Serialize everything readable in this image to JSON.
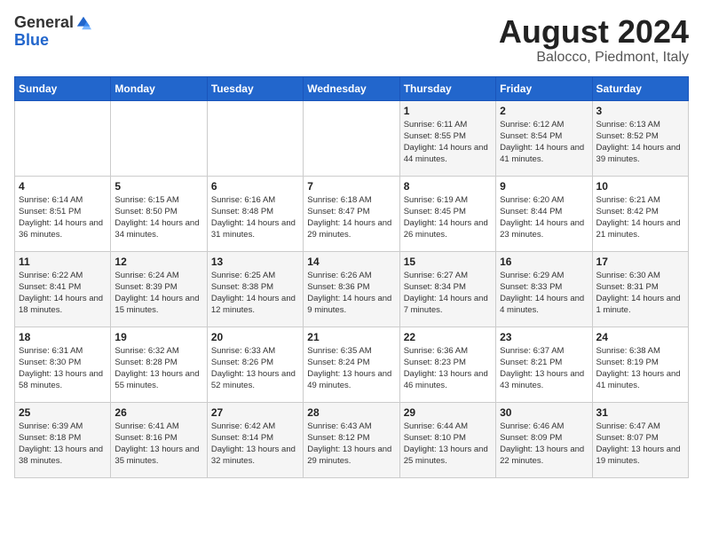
{
  "header": {
    "logo_general": "General",
    "logo_blue": "Blue",
    "title": "August 2024",
    "subtitle": "Balocco, Piedmont, Italy"
  },
  "weekdays": [
    "Sunday",
    "Monday",
    "Tuesday",
    "Wednesday",
    "Thursday",
    "Friday",
    "Saturday"
  ],
  "weeks": [
    [
      {
        "day": "",
        "info": ""
      },
      {
        "day": "",
        "info": ""
      },
      {
        "day": "",
        "info": ""
      },
      {
        "day": "",
        "info": ""
      },
      {
        "day": "1",
        "info": "Sunrise: 6:11 AM\nSunset: 8:55 PM\nDaylight: 14 hours and 44 minutes."
      },
      {
        "day": "2",
        "info": "Sunrise: 6:12 AM\nSunset: 8:54 PM\nDaylight: 14 hours and 41 minutes."
      },
      {
        "day": "3",
        "info": "Sunrise: 6:13 AM\nSunset: 8:52 PM\nDaylight: 14 hours and 39 minutes."
      }
    ],
    [
      {
        "day": "4",
        "info": "Sunrise: 6:14 AM\nSunset: 8:51 PM\nDaylight: 14 hours and 36 minutes."
      },
      {
        "day": "5",
        "info": "Sunrise: 6:15 AM\nSunset: 8:50 PM\nDaylight: 14 hours and 34 minutes."
      },
      {
        "day": "6",
        "info": "Sunrise: 6:16 AM\nSunset: 8:48 PM\nDaylight: 14 hours and 31 minutes."
      },
      {
        "day": "7",
        "info": "Sunrise: 6:18 AM\nSunset: 8:47 PM\nDaylight: 14 hours and 29 minutes."
      },
      {
        "day": "8",
        "info": "Sunrise: 6:19 AM\nSunset: 8:45 PM\nDaylight: 14 hours and 26 minutes."
      },
      {
        "day": "9",
        "info": "Sunrise: 6:20 AM\nSunset: 8:44 PM\nDaylight: 14 hours and 23 minutes."
      },
      {
        "day": "10",
        "info": "Sunrise: 6:21 AM\nSunset: 8:42 PM\nDaylight: 14 hours and 21 minutes."
      }
    ],
    [
      {
        "day": "11",
        "info": "Sunrise: 6:22 AM\nSunset: 8:41 PM\nDaylight: 14 hours and 18 minutes."
      },
      {
        "day": "12",
        "info": "Sunrise: 6:24 AM\nSunset: 8:39 PM\nDaylight: 14 hours and 15 minutes."
      },
      {
        "day": "13",
        "info": "Sunrise: 6:25 AM\nSunset: 8:38 PM\nDaylight: 14 hours and 12 minutes."
      },
      {
        "day": "14",
        "info": "Sunrise: 6:26 AM\nSunset: 8:36 PM\nDaylight: 14 hours and 9 minutes."
      },
      {
        "day": "15",
        "info": "Sunrise: 6:27 AM\nSunset: 8:34 PM\nDaylight: 14 hours and 7 minutes."
      },
      {
        "day": "16",
        "info": "Sunrise: 6:29 AM\nSunset: 8:33 PM\nDaylight: 14 hours and 4 minutes."
      },
      {
        "day": "17",
        "info": "Sunrise: 6:30 AM\nSunset: 8:31 PM\nDaylight: 14 hours and 1 minute."
      }
    ],
    [
      {
        "day": "18",
        "info": "Sunrise: 6:31 AM\nSunset: 8:30 PM\nDaylight: 13 hours and 58 minutes."
      },
      {
        "day": "19",
        "info": "Sunrise: 6:32 AM\nSunset: 8:28 PM\nDaylight: 13 hours and 55 minutes."
      },
      {
        "day": "20",
        "info": "Sunrise: 6:33 AM\nSunset: 8:26 PM\nDaylight: 13 hours and 52 minutes."
      },
      {
        "day": "21",
        "info": "Sunrise: 6:35 AM\nSunset: 8:24 PM\nDaylight: 13 hours and 49 minutes."
      },
      {
        "day": "22",
        "info": "Sunrise: 6:36 AM\nSunset: 8:23 PM\nDaylight: 13 hours and 46 minutes."
      },
      {
        "day": "23",
        "info": "Sunrise: 6:37 AM\nSunset: 8:21 PM\nDaylight: 13 hours and 43 minutes."
      },
      {
        "day": "24",
        "info": "Sunrise: 6:38 AM\nSunset: 8:19 PM\nDaylight: 13 hours and 41 minutes."
      }
    ],
    [
      {
        "day": "25",
        "info": "Sunrise: 6:39 AM\nSunset: 8:18 PM\nDaylight: 13 hours and 38 minutes."
      },
      {
        "day": "26",
        "info": "Sunrise: 6:41 AM\nSunset: 8:16 PM\nDaylight: 13 hours and 35 minutes."
      },
      {
        "day": "27",
        "info": "Sunrise: 6:42 AM\nSunset: 8:14 PM\nDaylight: 13 hours and 32 minutes."
      },
      {
        "day": "28",
        "info": "Sunrise: 6:43 AM\nSunset: 8:12 PM\nDaylight: 13 hours and 29 minutes."
      },
      {
        "day": "29",
        "info": "Sunrise: 6:44 AM\nSunset: 8:10 PM\nDaylight: 13 hours and 25 minutes."
      },
      {
        "day": "30",
        "info": "Sunrise: 6:46 AM\nSunset: 8:09 PM\nDaylight: 13 hours and 22 minutes."
      },
      {
        "day": "31",
        "info": "Sunrise: 6:47 AM\nSunset: 8:07 PM\nDaylight: 13 hours and 19 minutes."
      }
    ]
  ]
}
